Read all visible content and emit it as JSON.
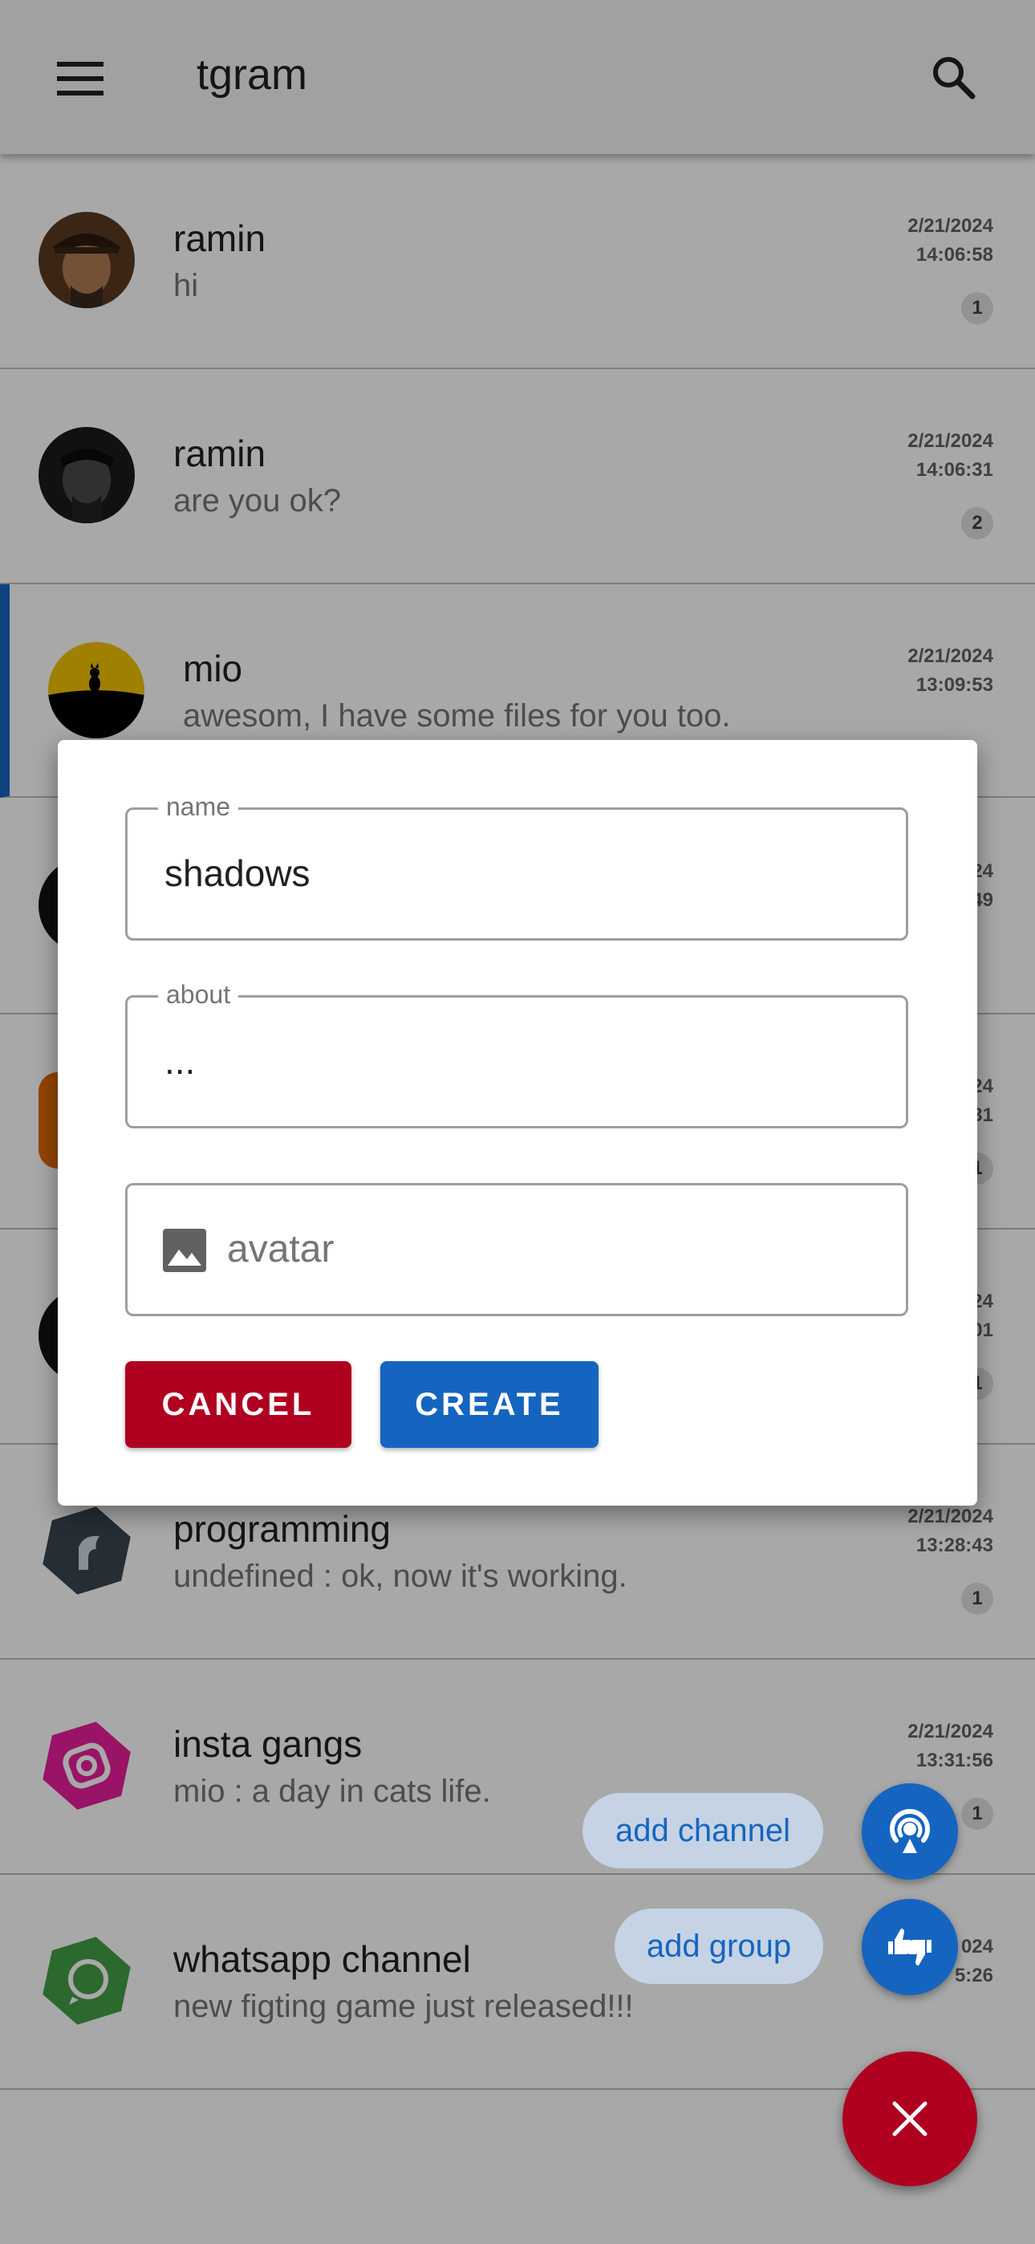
{
  "app": {
    "title": "tgram"
  },
  "colors": {
    "accent": "#1565c0",
    "danger": "#b00020"
  },
  "chats": [
    {
      "name": "ramin",
      "message": "hi",
      "date": "2/21/2024",
      "time": "14:06:58",
      "badge": "1",
      "avatar": "pirate-portrait"
    },
    {
      "name": "ramin",
      "message": "are you ok?",
      "date": "2/21/2024",
      "time": "14:06:31",
      "badge": "2",
      "avatar": "pirate-dark-portrait"
    },
    {
      "name": "mio",
      "message": "awesom, I have some files for you too.",
      "date": "2/21/2024",
      "time": "13:09:53",
      "badge": "",
      "avatar": "cat-sunset"
    },
    {
      "name": "",
      "message": "",
      "date": "24",
      "time": "49",
      "badge": "",
      "avatar": "black-circle"
    },
    {
      "name": "",
      "message": "",
      "date": "24",
      "time": "31",
      "badge": "1",
      "avatar": "orange-shape"
    },
    {
      "name": "",
      "message": "",
      "date": "24",
      "time": "01",
      "badge": "1",
      "avatar": "black-circle"
    },
    {
      "name": "programming",
      "message": "undefined : ok, now it's working.",
      "date": "2/21/2024",
      "time": "13:28:43",
      "badge": "1",
      "avatar": "dark-app-icon"
    },
    {
      "name": "insta gangs",
      "message": "mio : a day in cats life.",
      "date": "2/21/2024",
      "time": "13:31:56",
      "badge": "1",
      "avatar": "instagram-icon"
    },
    {
      "name": "whatsapp channel",
      "message": "new figting game just released!!!",
      "date": "024",
      "time": "5:26",
      "badge": "",
      "avatar": "whatsapp-icon"
    }
  ],
  "fab": {
    "add_channel": "add channel",
    "add_group": "add group"
  },
  "dialog": {
    "name_label": "name",
    "name_value": "shadows",
    "about_label": "about",
    "about_value": "...",
    "avatar_placeholder": "avatar",
    "cancel_label": "CANCEL",
    "create_label": "CREATE"
  }
}
